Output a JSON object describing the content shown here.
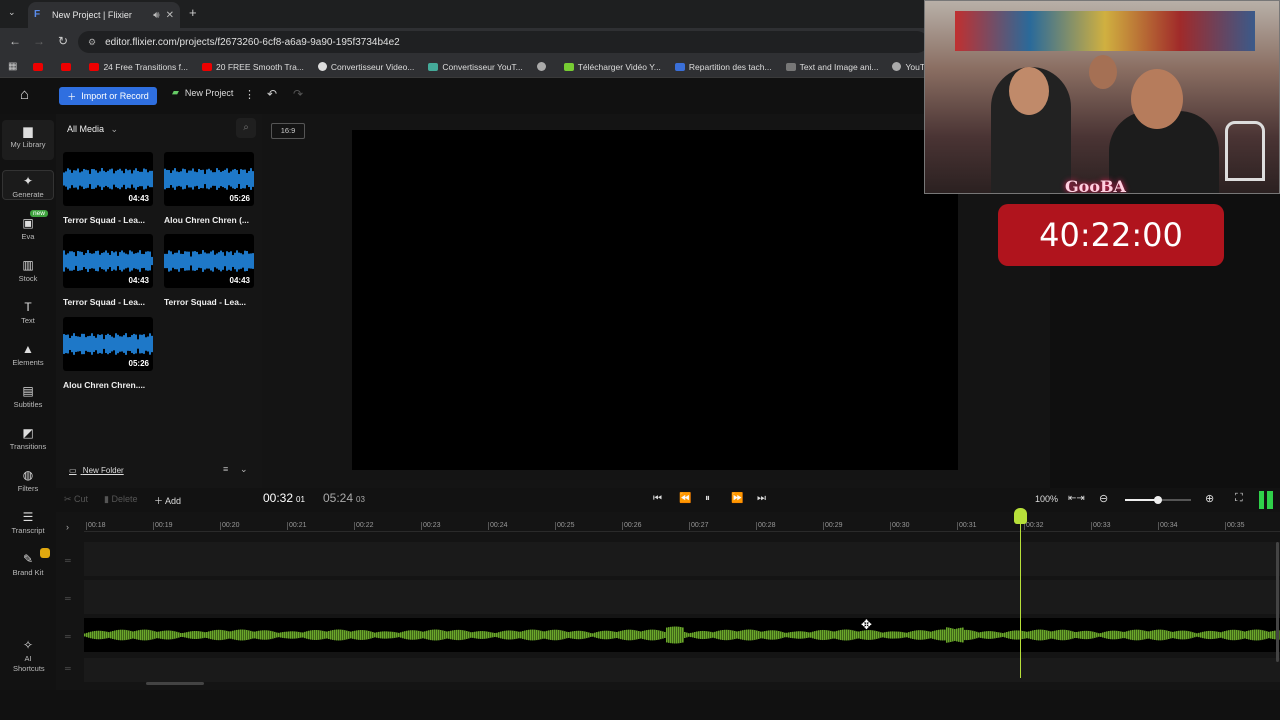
{
  "browser": {
    "tab_title": "New Project | Flixier",
    "url": "editor.flixier.com/projects/f2673260-6cf8-a6a9-9a90-195f3734b4e2",
    "bookmarks": [
      "24 Free Transitions f...",
      "20 FREE Smooth Tra...",
      "Convertisseur Video...",
      "Convertisseur YouT...",
      "Télécharger Vidéo Y...",
      "Repartition des tach...",
      "Text and Image ani...",
      "YouTube Converter..."
    ]
  },
  "toolbar": {
    "import_label": "Import or Record",
    "new_project_label": "New Project"
  },
  "leftnav": [
    {
      "label": "My Library"
    },
    {
      "label": "Generate"
    },
    {
      "label": "Eva",
      "badge": "new"
    },
    {
      "label": "Stock"
    },
    {
      "label": "Text"
    },
    {
      "label": "Elements"
    },
    {
      "label": "Subtitles"
    },
    {
      "label": "Transitions"
    },
    {
      "label": "Filters"
    },
    {
      "label": "Transcript"
    },
    {
      "label": "Brand Kit"
    },
    {
      "label": "AI Shortcuts"
    }
  ],
  "library": {
    "filter_label": "All Media",
    "items": [
      {
        "name": "Terror Squad - Lea...",
        "duration": "04:43"
      },
      {
        "name": "Alou Chren Chren (...",
        "duration": "05:26"
      },
      {
        "name": "Terror Squad - Lea...",
        "duration": "04:43"
      },
      {
        "name": "Terror Squad - Lea...",
        "duration": "04:43"
      },
      {
        "name": "Alou Chren Chren....",
        "duration": "05:26"
      }
    ],
    "new_folder_label": "New Folder"
  },
  "preview": {
    "aspect_ratio": "16:9"
  },
  "controls": {
    "cut_label": "Cut",
    "delete_label": "Delete",
    "add_label": "Add",
    "current_time": "00:32",
    "current_frames": "01",
    "total_time": "05:24",
    "total_frames": "03",
    "zoom": "100%",
    "zoom_level": 0.5
  },
  "timeline": {
    "ticks": [
      "00:18",
      "00:19",
      "00:20",
      "00:21",
      "00:22",
      "00:23",
      "00:24",
      "00:25",
      "00:26",
      "00:27",
      "00:28",
      "00:29",
      "00:30",
      "00:31",
      "00:32",
      "00:33",
      "00:34",
      "00:35"
    ],
    "playhead_time": "00:32",
    "audio_color": "#6aa82a"
  },
  "overlay": {
    "timer": "40:22:00",
    "sign_text": "GooBA"
  },
  "colors": {
    "accent": "#2f6fe0",
    "waveform_blue": "#1e78c8",
    "playhead": "#b7e03a",
    "timer_red": "#b0141d"
  }
}
